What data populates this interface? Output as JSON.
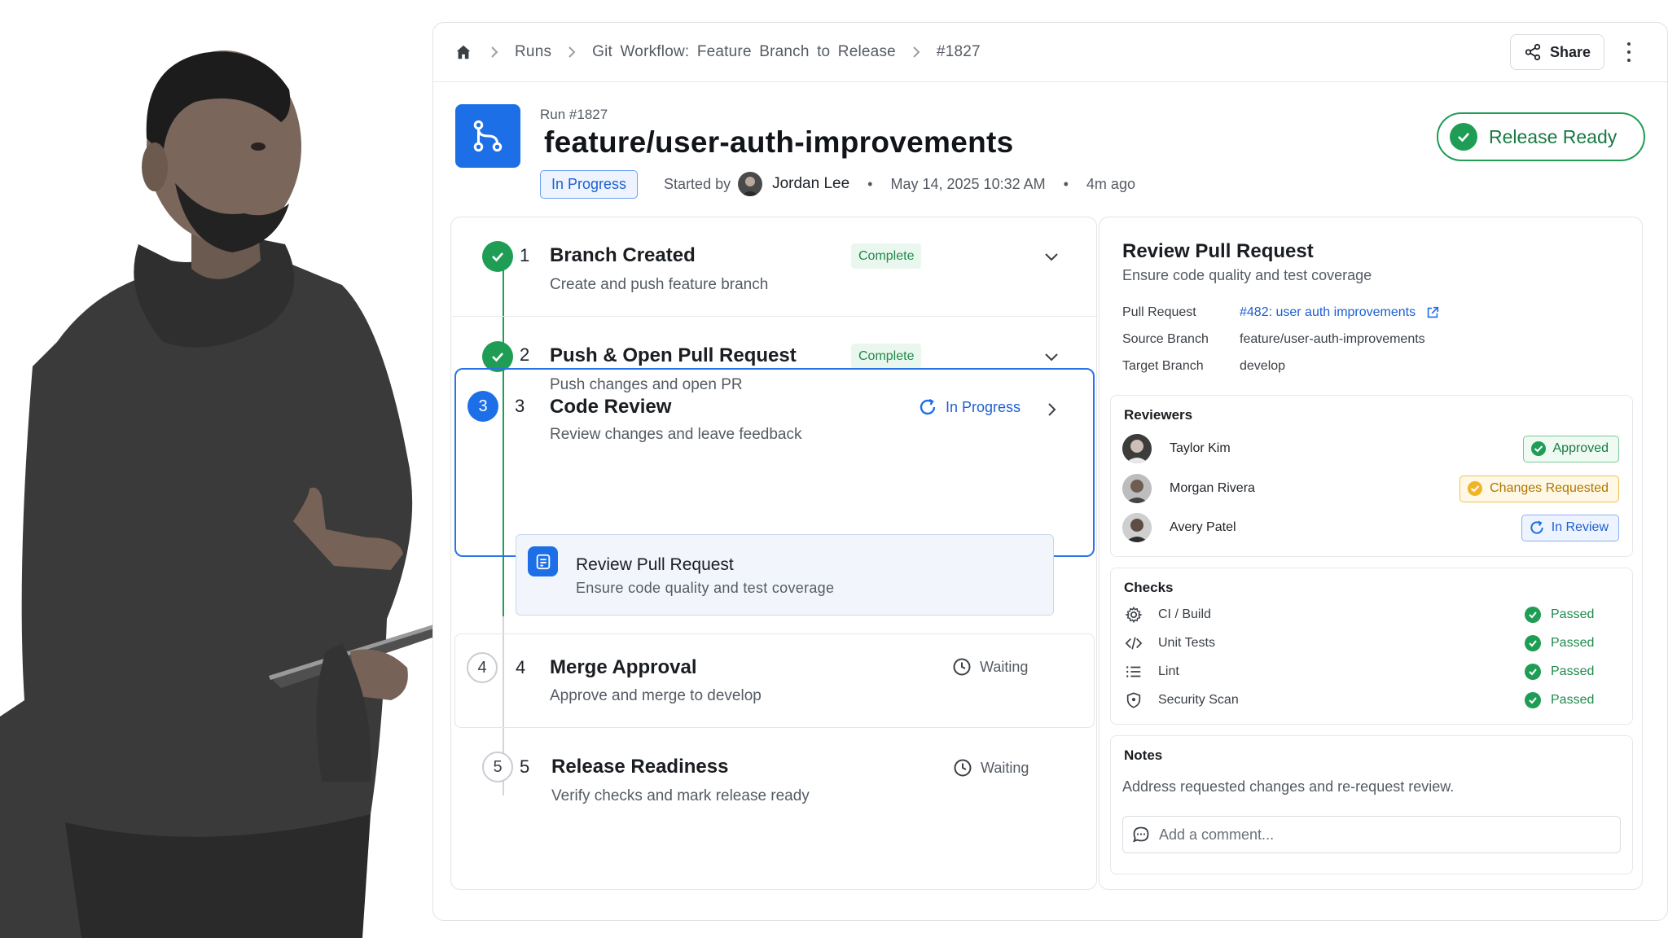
{
  "breadcrumb": {
    "items": [
      "Runs",
      "Git Workflow: Feature Branch to Release",
      "#1827"
    ]
  },
  "toolbar": {
    "share_label": "Share"
  },
  "run": {
    "id_label": "Run #1827",
    "branch_title": "feature/user-auth-improvements",
    "status": "In Progress",
    "started_by_label": "Started by",
    "user": "Jordan Lee",
    "date": "May 14, 2025 10:32 AM",
    "relative_time": "4m ago",
    "release_label": "Release Ready"
  },
  "steps": [
    {
      "num": "1",
      "title": "Branch Created",
      "desc": "Create and push feature branch",
      "status": "Complete"
    },
    {
      "num": "2",
      "title": "Push & Open Pull Request",
      "desc": "Push changes and open PR",
      "status": "Complete"
    },
    {
      "num": "3",
      "title": "Code Review",
      "desc": "Review changes and leave feedback",
      "status": "In Progress",
      "subtask": {
        "title": "Review Pull Request",
        "desc": "Ensure code quality and test coverage"
      }
    },
    {
      "num": "4",
      "title": "Merge Approval",
      "desc": "Approve and merge to develop",
      "status": "Waiting"
    },
    {
      "num": "5",
      "title": "Release Readiness",
      "desc": "Verify checks and mark release ready",
      "status": "Waiting"
    }
  ],
  "detail": {
    "title": "Review Pull Request",
    "subtitle": "Ensure code quality and test coverage",
    "fields": [
      {
        "key": "Pull Request",
        "value": "#482: user auth improvements"
      },
      {
        "key": "Source Branch",
        "value": "feature/user-auth-improvements"
      },
      {
        "key": "Target Branch",
        "value": "develop"
      }
    ],
    "reviewers_title": "Reviewers",
    "reviewers": [
      {
        "name": "Taylor Kim",
        "status": "Approved"
      },
      {
        "name": "Morgan Rivera",
        "status": "Changes Requested"
      },
      {
        "name": "Avery Patel",
        "status": "In Review"
      }
    ],
    "checks_title": "Checks",
    "checks": [
      {
        "name": "CI / Build",
        "icon": "gear-icon",
        "status": "Passed"
      },
      {
        "name": "Unit Tests",
        "icon": "code-icon",
        "status": "Passed"
      },
      {
        "name": "Lint",
        "icon": "list-icon",
        "status": "Passed"
      },
      {
        "name": "Security Scan",
        "icon": "shield-icon",
        "status": "Passed"
      }
    ],
    "notes_title": "Notes",
    "notes_text": "Address requested changes and re-request review.",
    "comment_placeholder": "Add a comment..."
  },
  "colors": {
    "accent": "#1d6fe8",
    "success": "#1f9d55",
    "warning": "#f0b429"
  }
}
